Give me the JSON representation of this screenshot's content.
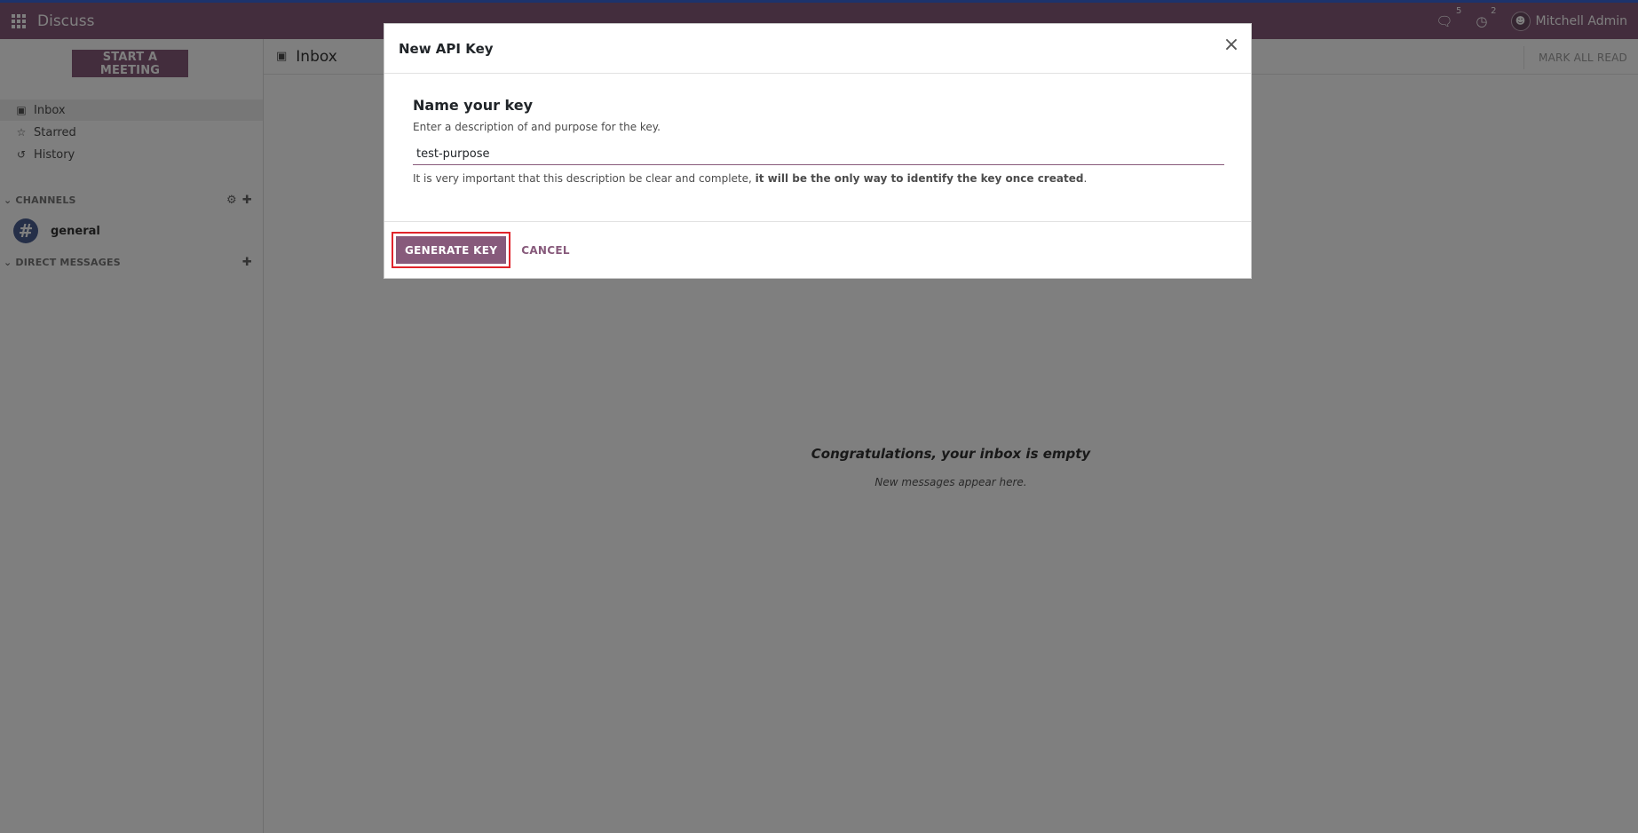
{
  "navbar": {
    "app_title": "Discuss",
    "messages_badge": "5",
    "activities_badge": "2",
    "user_name": "Mitchell Admin"
  },
  "sidebar": {
    "start_meeting": "START A MEETING",
    "items": [
      {
        "label": "Inbox",
        "icon": "inbox-icon"
      },
      {
        "label": "Starred",
        "icon": "star-icon"
      },
      {
        "label": "History",
        "icon": "history-icon"
      }
    ],
    "channels_label": "CHANNELS",
    "channel_name": "general",
    "direct_messages_label": "DIRECT MESSAGES"
  },
  "main": {
    "title": "Inbox",
    "mark_all_read": "MARK ALL READ",
    "empty_title": "Congratulations, your inbox is empty",
    "empty_subtitle": "New messages appear here."
  },
  "modal": {
    "title": "New API Key",
    "heading": "Name your key",
    "description": "Enter a description of and purpose for the key.",
    "input_value": "test-purpose",
    "warning_prefix": "It is very important that this description be clear and complete, ",
    "warning_bold": "it will be the only way to identify the key once created",
    "warning_suffix": ".",
    "generate_label": "GENERATE KEY",
    "cancel_label": "CANCEL"
  },
  "colors": {
    "brand": "#875a7b",
    "highlight": "#e0242b",
    "top_accent": "#3a66d8"
  }
}
